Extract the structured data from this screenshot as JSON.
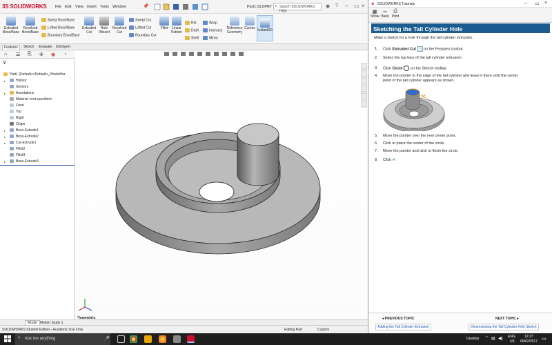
{
  "sw": {
    "logo_brand": "3S SOLIDWORKS",
    "menus": [
      "File",
      "Edit",
      "View",
      "Insert",
      "Tools",
      "Window"
    ],
    "filename": "Part1.SLDPRT",
    "search_placeholder": "Search SOLIDWORKS Help",
    "features": [
      {
        "label": "Extruded Boss/Base"
      },
      {
        "label": "Revolved Boss/Base"
      },
      {
        "label": "Extruded Cut"
      },
      {
        "label": "Hole Wizard"
      },
      {
        "label": "Revolved Cut"
      },
      {
        "label": "Fillet"
      },
      {
        "label": "Linear Pattern"
      },
      {
        "label": "Reference Geometry"
      },
      {
        "label": "Curves"
      },
      {
        "label": "Instant3D"
      }
    ],
    "small_tools": [
      "Swept Boss/Base",
      "Lofted Boss/Base",
      "Boundary Boss/Base",
      "Swept Cut",
      "Lofted Cut",
      "Boundary Cut",
      "Rib",
      "Draft",
      "Shell",
      "Wrap",
      "Intersect",
      "Mirror"
    ],
    "cm_tabs": [
      "Features",
      "Sketch",
      "Evaluate",
      "DimXpert"
    ],
    "tree": {
      "root": "Part1 (Default<<Default>_PhotoWor",
      "items": [
        "History",
        "Sensors",
        "Annotations",
        "Material <not specified>",
        "Front",
        "Top",
        "Right",
        "Origin",
        "Boss-Extrude1",
        "Boss-Extrude2",
        "Cut-Extrude1",
        "Fillet2",
        "Fillet3",
        "Boss-Extrude3"
      ]
    },
    "view_label": "*Isometric",
    "bottom_tabs": [
      "Model",
      "Motion Study 1"
    ],
    "status": {
      "left": "SOLIDWORKS Student Edition - Academic Use Only",
      "mode": "Editing Part",
      "units": "Custom"
    }
  },
  "tutorial": {
    "window_title": "SOLIDWORKS Tutorials",
    "tools": [
      "Show",
      "Back",
      "Print"
    ],
    "heading": "Sketching the Tall Cylinder Hole",
    "intro": "Make a sketch for a hole through the tall cylinder extrusion.",
    "steps": [
      {
        "n": "1.",
        "pre": "Click ",
        "bold": "Extruded Cut",
        "post": " on the Features toolbar."
      },
      {
        "n": "2.",
        "pre": "Select the top face of the tall cylinder extrusion.",
        "bold": "",
        "post": ""
      },
      {
        "n": "3.",
        "pre": "Click ",
        "bold": "Circle",
        "post": " on the Sketch toolbar."
      },
      {
        "n": "4.",
        "pre": "Move the pointer to the edge of the tall cylinder and leave it there until the center",
        "bold": "",
        "post": ""
      },
      {
        "n": "",
        "pre": "point of the tall cylinder appears as shown.",
        "bold": "",
        "post": ""
      },
      {
        "n": "5.",
        "pre": "Move the pointer over the new center point.",
        "bold": "",
        "post": ""
      },
      {
        "n": "6.",
        "pre": "Click to place the center of the circle.",
        "bold": "",
        "post": ""
      },
      {
        "n": "7.",
        "pre": "Move the pointer and click to finish the circle.",
        "bold": "",
        "post": ""
      },
      {
        "n": "8.",
        "pre": "Click ",
        "bold": "",
        "post": "."
      }
    ],
    "prev_label": "Previous topic",
    "next_label": "Next topic",
    "prev_link": "Adding the Tall Cylinder Extrusion",
    "next_link": "Dimensioning the Tall Cylinder Hole Sketch"
  },
  "taskbar": {
    "search": "Ask me anything",
    "desktop": "Desktop",
    "lang": "ENG",
    "region": "UK",
    "time": "12:27",
    "date": "09/02/2017"
  },
  "colors": {
    "accent": "#1b5d91",
    "brand": "#c8102e",
    "taskbar": "#1f1f1f"
  }
}
